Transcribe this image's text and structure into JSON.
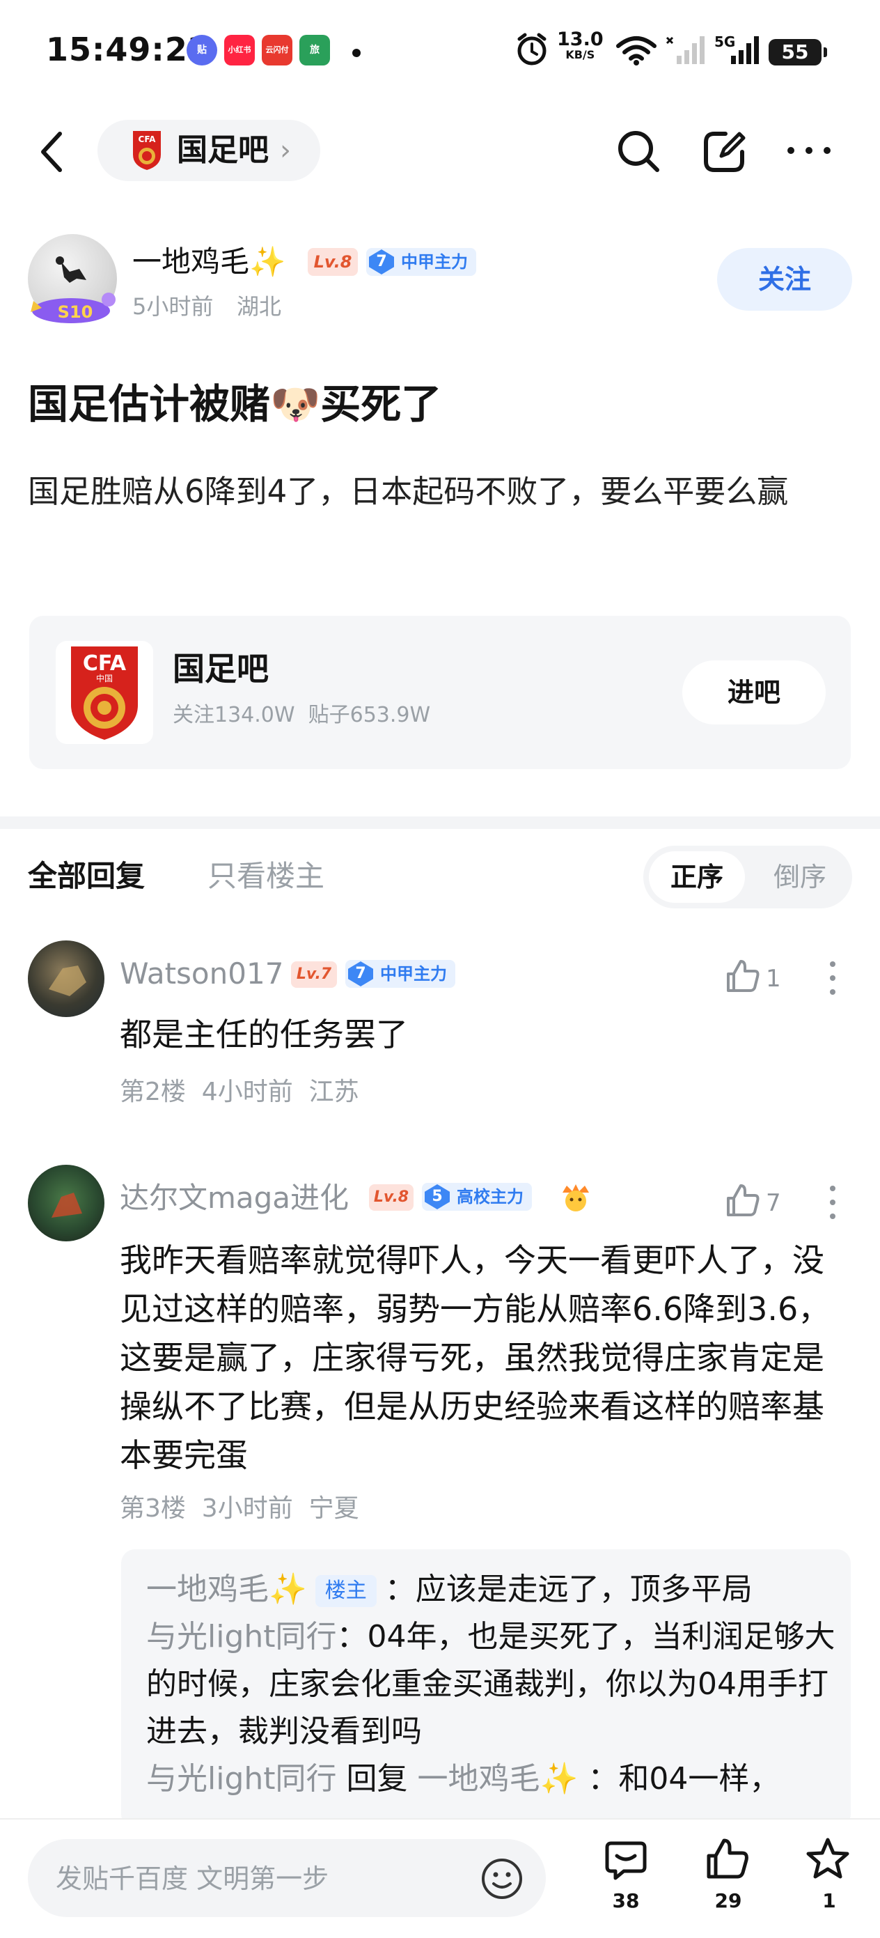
{
  "status_bar": {
    "time": "15:49:22",
    "apps": [
      "贴",
      "小红书",
      "云闪付",
      "旅"
    ],
    "net_speed": "13.0",
    "net_unit": "KB/S",
    "network": "5G",
    "battery": "55"
  },
  "nav": {
    "forum_name": "国足吧",
    "back_icon": "back-arrow-icon",
    "search_icon": "search-icon",
    "edit_icon": "edit-icon",
    "more_icon": "more-icon"
  },
  "author": {
    "name": "一地鸡毛✨",
    "level": "Lv.8",
    "rank_num": "7",
    "rank_label": "中甲主力",
    "time": "5小时前",
    "location": "湖北",
    "badge": "S10",
    "follow_label": "关注"
  },
  "post": {
    "title": "国足估计被赌🐶买死了",
    "body": "国足胜赔从6降到4了，日本起码不败了，要么平要么赢"
  },
  "forum_card": {
    "name": "国足吧",
    "stats": "关注134.0W  贴子653.9W",
    "enter_label": "进吧",
    "logo_text": "CFA",
    "logo_sub": "中国"
  },
  "tabs": {
    "all": "全部回复",
    "op_only": "只看楼主",
    "sort_asc": "正序",
    "sort_desc": "倒序"
  },
  "comments": [
    {
      "name": "Watson017",
      "level": "Lv.7",
      "rank_num": "7",
      "rank_label": "中甲主力",
      "likes": "1",
      "text": "都是主任的任务罢了",
      "meta": "第2楼  4小时前  江苏"
    },
    {
      "name": "达尔文maga进化",
      "level": "Lv.8",
      "rank_num": "5",
      "rank_label": "高校主力",
      "likes": "7",
      "text": "我昨天看赔率就觉得吓人，今天一看更吓人了，没见过这样的赔率，弱势一方能从赔率6.6降到3.6，这要是赢了，庄家得亏死，虽然我觉得庄家肯定是操纵不了比赛，但是从历史经验来看这样的赔率基本要完蛋",
      "meta": "第3楼  3小时前  宁夏",
      "replies": [
        {
          "user": "一地鸡毛✨",
          "tag": "楼主",
          "text": "：应该是走远了，顶多平局"
        },
        {
          "user": "与光light同行",
          "text": "：04年，也是买死了，当利润足够大的时候，庄家会化重金买通裁判，你以为04用手打进去，裁判没看到吗"
        },
        {
          "user": "与光light同行",
          "reply_word": "回复",
          "reply_to": "一地鸡毛✨",
          "text": "：和04一样，"
        }
      ]
    }
  ],
  "bottom_bar": {
    "placeholder": "发贴千百度 文明第一步",
    "comment_count": "38",
    "like_count": "29",
    "fav_count": "1"
  },
  "colors": {
    "accent": "#2f7bf0",
    "level": "#e2562f",
    "muted": "#9aa0a6"
  }
}
